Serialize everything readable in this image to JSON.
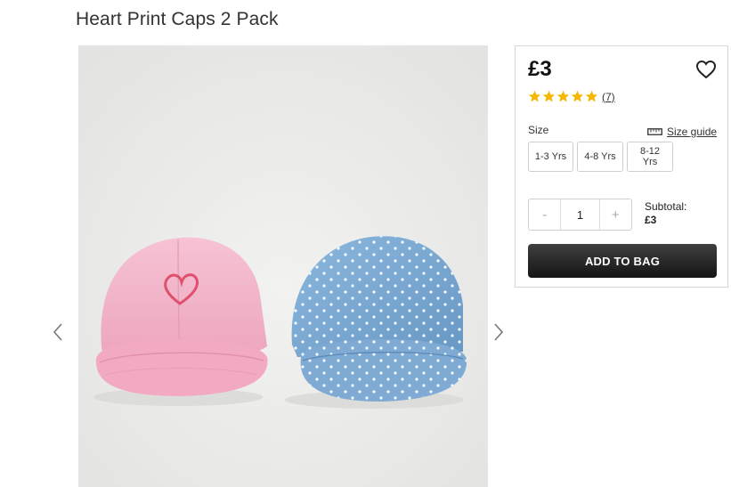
{
  "product": {
    "title": "Heart Print Caps 2 Pack",
    "price": "£3",
    "rating": 5,
    "review_count": "(7)"
  },
  "colors": {
    "star": "#f5b800",
    "button_bg": "#1f1f1f",
    "pink_cap": "#f3b8cc",
    "blue_cap": "#79a9d4"
  },
  "icons": {
    "wishlist": "heart-outline-icon",
    "size_guide": "ruler-icon",
    "prev": "chevron-left-icon",
    "next": "chevron-right-icon"
  },
  "sizes": {
    "label": "Size",
    "guide_label": "Size guide",
    "options": [
      "1-3 Yrs",
      "4-8 Yrs",
      "8-12 Yrs"
    ]
  },
  "quantity": {
    "minus": "-",
    "value": "1",
    "plus": "+"
  },
  "subtotal": {
    "label": "Subtotal:",
    "amount": "£3"
  },
  "cta": {
    "add_to_bag": "ADD TO BAG"
  }
}
